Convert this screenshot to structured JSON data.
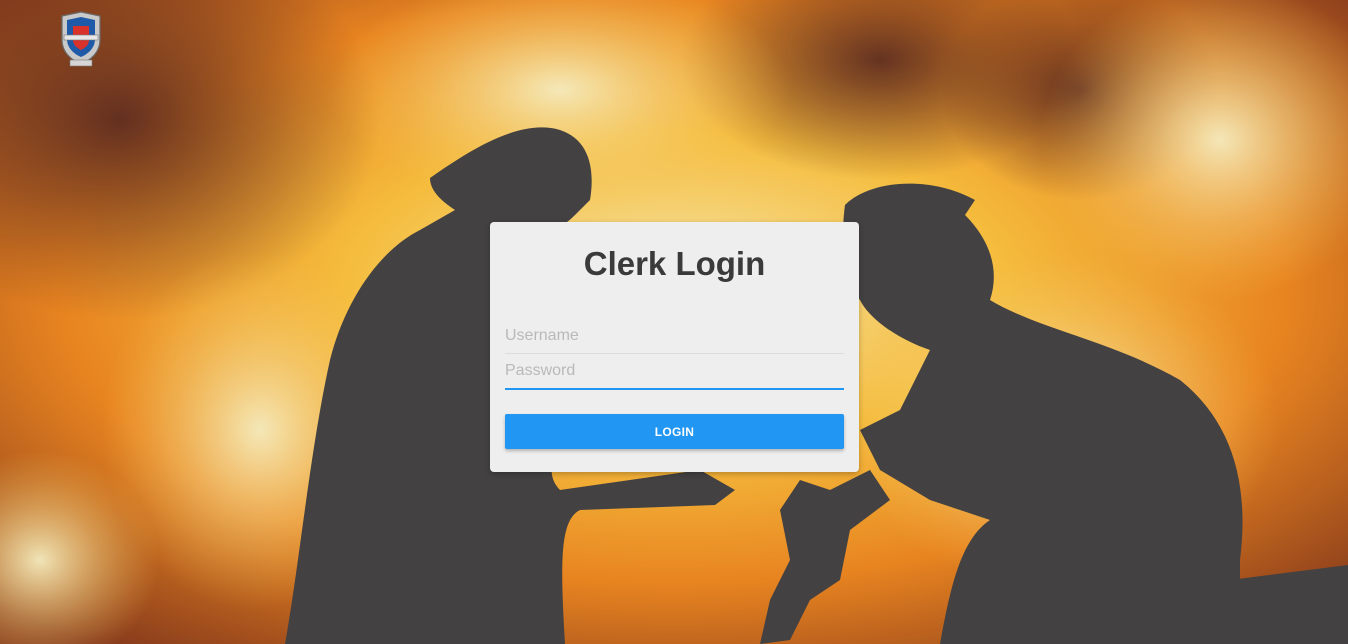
{
  "login_card": {
    "title": "Clerk Login",
    "username_placeholder": "Username",
    "username_value": "",
    "password_placeholder": "Password",
    "password_value": "",
    "login_label": "LOGIN"
  },
  "colors": {
    "accent": "#2196f3",
    "card_bg": "#eeeeee",
    "title_text": "#3a3a3a"
  },
  "icons": {
    "logo": "fire-department-crest-logo"
  }
}
